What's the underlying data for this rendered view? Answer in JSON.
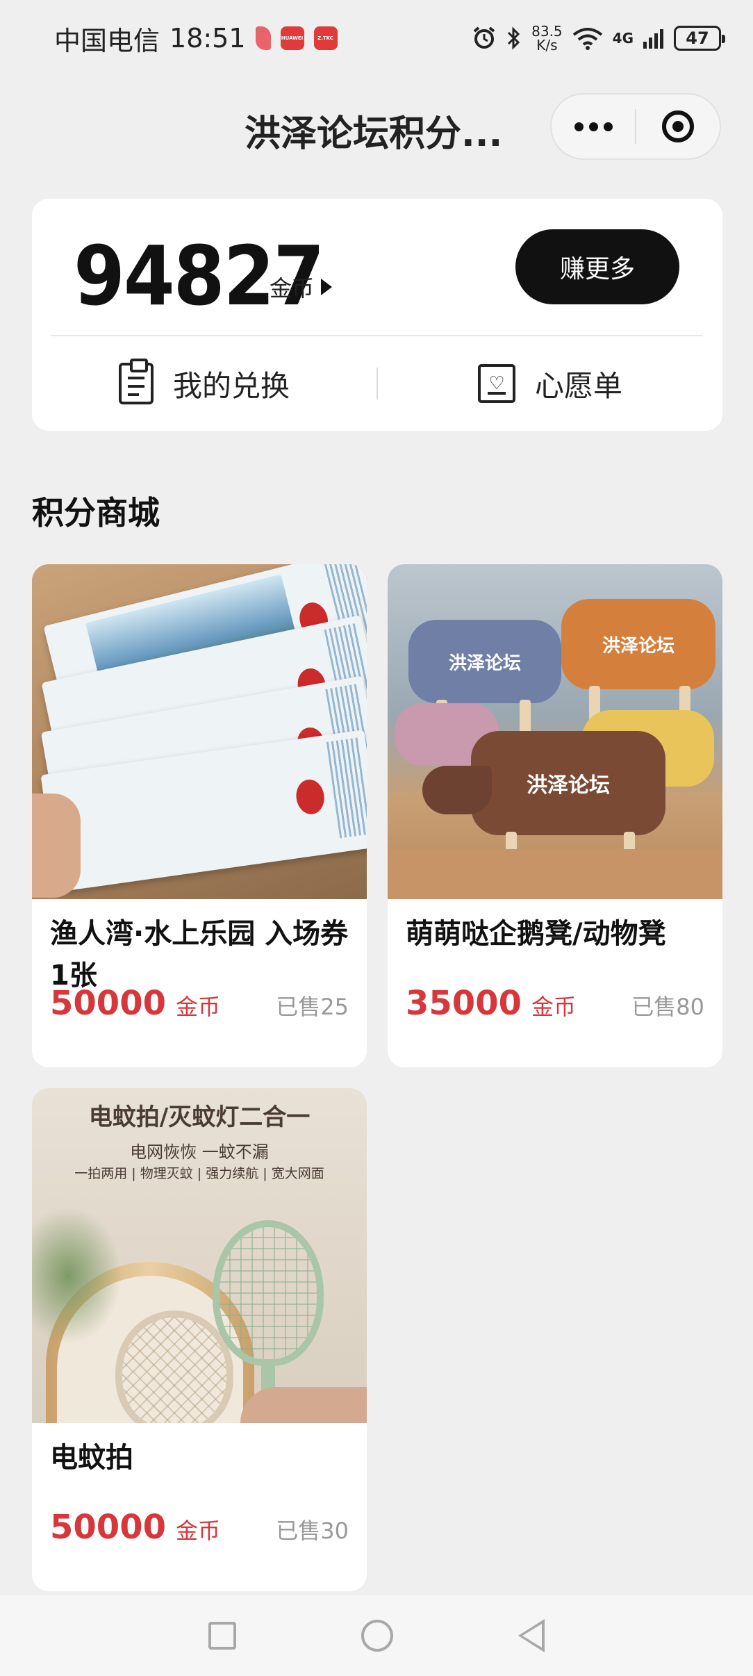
{
  "status_bar": {
    "carrier": "中国电信",
    "time": "18:51",
    "net_speed_value": "83.5",
    "net_speed_unit": "K/s",
    "network": "4G",
    "battery": "47",
    "app_badge_1": "HUAWEI",
    "app_badge_2": "Z.TKC"
  },
  "header": {
    "title": "洪泽论坛积分..."
  },
  "points_card": {
    "points": "94827",
    "unit": "金币",
    "earn_more_label": "赚更多",
    "my_exchange_label": "我的兑换",
    "wishlist_label": "心愿单"
  },
  "section": {
    "title": "积分商城"
  },
  "products": [
    {
      "name": "渔人湾·水上乐园 入场券1张",
      "price": "50000",
      "unit": "金币",
      "sold": "已售25"
    },
    {
      "name": "萌萌哒企鹅凳/动物凳",
      "price": "35000",
      "unit": "金币",
      "sold": "已售80",
      "image_text": {
        "brand": "洪泽论坛"
      }
    },
    {
      "name": "电蚊拍",
      "price": "50000",
      "unit": "金币",
      "sold": "已售30",
      "image_text": {
        "headline": "电蚊拍/灭蚊灯二合一",
        "sub": "电网恢恢 一蚊不漏",
        "features": "一拍两用 | 物理灭蚊 | 强力续航 | 宽大网面"
      }
    }
  ],
  "colors": {
    "accent_price": "#d6373b",
    "button_dark": "#111111",
    "page_bg": "#efefef"
  },
  "icons": {
    "status": [
      "alarm-icon",
      "bluetooth-icon",
      "wifi-icon",
      "signal-icon",
      "battery-icon"
    ],
    "card": [
      "clipboard-icon",
      "heart-box-icon"
    ],
    "nav": [
      "recent-apps-icon",
      "home-icon",
      "back-icon"
    ]
  }
}
